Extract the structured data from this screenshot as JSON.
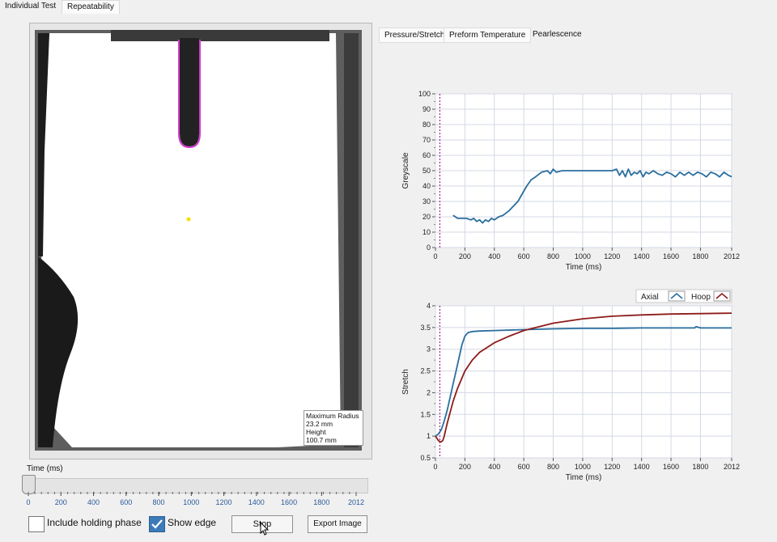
{
  "tabs": [
    {
      "label": "Individual Test",
      "active": true
    },
    {
      "label": "Repeatability",
      "active": false
    }
  ],
  "subtabs": [
    {
      "label": "Pressure/Stretch",
      "active": false
    },
    {
      "label": "Preform Temperature",
      "active": false
    },
    {
      "label": "Pearlescence",
      "active": true
    }
  ],
  "image_panel": {
    "annotation_lines": [
      "Maximum Radius",
      "23.2 mm",
      "Height",
      "100.7 mm"
    ],
    "edge_color": "#d23cd2",
    "marker_color": "#f6e000"
  },
  "time_slider": {
    "label": "Time (ms)",
    "value": 0,
    "min": 0,
    "max": 2012,
    "tick_labels": [
      "0",
      "200",
      "400",
      "600",
      "800",
      "1000",
      "1200",
      "1400",
      "1600",
      "1800",
      "2012"
    ]
  },
  "controls": {
    "include_holding_phase": {
      "label": "Include holding phase",
      "checked": false
    },
    "show_edge": {
      "label": "Show edge",
      "checked": true
    },
    "stop_label": "Stop",
    "export_label": "Export Image"
  },
  "chart_data": [
    {
      "type": "line",
      "xlabel": "Time (ms)",
      "ylabel": "Greyscale",
      "xlim": [
        0,
        2012
      ],
      "ylim": [
        0,
        100
      ],
      "xticks": [
        "0",
        "200",
        "400",
        "600",
        "800",
        "1000",
        "1200",
        "1400",
        "1600",
        "1800",
        "2012"
      ],
      "yticks": [
        "0",
        "10",
        "20",
        "30",
        "40",
        "50",
        "60",
        "70",
        "80",
        "90",
        "100"
      ],
      "cursor_x": 30,
      "grid": true,
      "series": [
        {
          "color": "#2a6e9e",
          "x": [
            120,
            150,
            180,
            210,
            240,
            260,
            280,
            300,
            320,
            340,
            360,
            380,
            400,
            430,
            460,
            500,
            530,
            560,
            590,
            620,
            650,
            680,
            720,
            760,
            780,
            800,
            820,
            860,
            900,
            950,
            1000,
            1050,
            1100,
            1150,
            1200,
            1230,
            1250,
            1270,
            1290,
            1310,
            1330,
            1350,
            1370,
            1390,
            1410,
            1430,
            1450,
            1480,
            1510,
            1540,
            1570,
            1600,
            1630,
            1660,
            1690,
            1720,
            1750,
            1780,
            1810,
            1840,
            1870,
            1900,
            1930,
            1960,
            1990,
            2012
          ],
          "y": [
            21,
            19,
            19,
            19,
            18,
            19,
            17,
            18,
            16,
            18,
            17,
            19,
            18,
            20,
            21,
            24,
            27,
            30,
            35,
            40,
            44,
            46,
            49,
            50,
            48,
            51,
            49,
            50,
            50,
            50,
            50,
            50,
            50,
            50,
            50,
            51,
            47,
            50,
            46,
            51,
            47,
            49,
            48,
            50,
            46,
            49,
            48,
            50,
            48,
            47,
            49,
            48,
            46,
            49,
            47,
            49,
            47,
            49,
            48,
            46,
            49,
            48,
            46,
            49,
            47,
            46
          ]
        }
      ]
    },
    {
      "type": "line",
      "xlabel": "Time (ms)",
      "ylabel": "Stretch",
      "xlim": [
        0,
        2012
      ],
      "ylim": [
        0.5,
        4
      ],
      "xticks": [
        "0",
        "200",
        "400",
        "600",
        "800",
        "1000",
        "1200",
        "1400",
        "1600",
        "1800",
        "2012"
      ],
      "yticks": [
        "0.5",
        "1",
        "1.5",
        "2",
        "2.5",
        "3",
        "3.5",
        "4"
      ],
      "cursor_x": 30,
      "grid": true,
      "legend_position": "top-right",
      "series": [
        {
          "name": "Axial",
          "color": "#2a6e9e",
          "x": [
            0,
            20,
            40,
            60,
            80,
            100,
            120,
            140,
            160,
            180,
            200,
            220,
            240,
            260,
            300,
            400,
            600,
            800,
            1000,
            1200,
            1400,
            1600,
            1760,
            1770,
            1800,
            2012
          ],
          "y": [
            1.0,
            1.05,
            1.15,
            1.35,
            1.6,
            1.9,
            2.2,
            2.5,
            2.8,
            3.1,
            3.3,
            3.38,
            3.4,
            3.41,
            3.42,
            3.43,
            3.45,
            3.47,
            3.48,
            3.48,
            3.49,
            3.49,
            3.49,
            3.52,
            3.49,
            3.49
          ]
        },
        {
          "name": "Hoop",
          "color": "#8e1b1b",
          "x": [
            0,
            20,
            30,
            40,
            50,
            60,
            70,
            80,
            100,
            120,
            150,
            200,
            250,
            300,
            400,
            500,
            600,
            800,
            1000,
            1200,
            1400,
            1600,
            1800,
            2012
          ],
          "y": [
            1.0,
            0.9,
            0.87,
            0.87,
            0.9,
            1.0,
            1.15,
            1.3,
            1.55,
            1.8,
            2.1,
            2.5,
            2.75,
            2.93,
            3.15,
            3.3,
            3.43,
            3.6,
            3.7,
            3.76,
            3.79,
            3.81,
            3.82,
            3.83
          ]
        }
      ]
    }
  ]
}
